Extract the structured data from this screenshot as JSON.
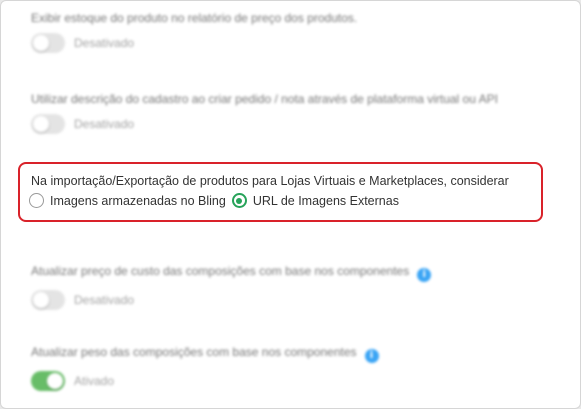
{
  "settings": [
    {
      "label": "Exibir estoque do produto no relatório de preço dos produtos.",
      "state": "Desativado",
      "on": false
    },
    {
      "label": "Utilizar descrição do cadastro ao criar pedido / nota através de plataforma virtual ou API",
      "state": "Desativado",
      "on": false
    }
  ],
  "highlighted": {
    "question": "Na importação/Exportação de produtos para Lojas Virtuais e Marketplaces, considerar",
    "options": [
      {
        "label": "Imagens armazenadas no Bling",
        "selected": false
      },
      {
        "label": "URL de Imagens Externas",
        "selected": true
      }
    ]
  },
  "settings_lower": [
    {
      "label": "Atualizar preço de custo das composições com base nos componentes",
      "state": "Desativado",
      "on": false,
      "info": "i"
    },
    {
      "label": "Atualizar peso das composições com base nos componentes",
      "state": "Ativado",
      "on": true,
      "info": "i"
    }
  ],
  "colors": {
    "highlight_border": "#d9222a",
    "radio_selected": "#27a35a",
    "toggle_on": "#5cb85c",
    "info": "#2a9df4"
  }
}
